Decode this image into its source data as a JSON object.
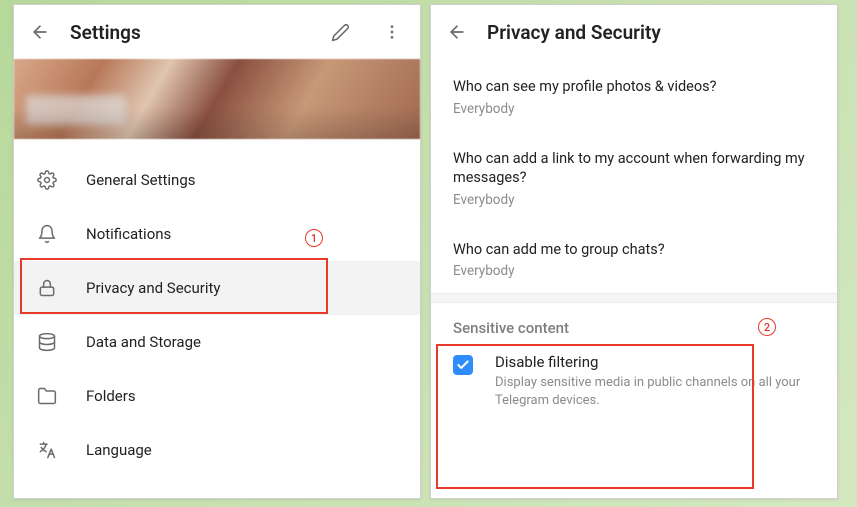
{
  "left": {
    "title": "Settings",
    "menu": [
      {
        "icon": "gear",
        "label": "General Settings"
      },
      {
        "icon": "bell",
        "label": "Notifications"
      },
      {
        "icon": "lock",
        "label": "Privacy and Security"
      },
      {
        "icon": "database",
        "label": "Data and Storage"
      },
      {
        "icon": "folder",
        "label": "Folders"
      },
      {
        "icon": "language",
        "label": "Language"
      }
    ]
  },
  "right": {
    "title": "Privacy and Security",
    "privacy_items": [
      {
        "question": "Who can see my profile photos & videos?",
        "value": "Everybody"
      },
      {
        "question": "Who can add a link to my account when forwarding my messages?",
        "value": "Everybody"
      },
      {
        "question": "Who can add me to group chats?",
        "value": "Everybody"
      }
    ],
    "sensitive": {
      "section_title": "Sensitive content",
      "checkbox_checked": true,
      "checkbox_label": "Disable filtering",
      "checkbox_desc": "Display sensitive media in public channels on all your Telegram devices."
    }
  },
  "annotations": {
    "badge1": "1",
    "badge2": "2"
  }
}
